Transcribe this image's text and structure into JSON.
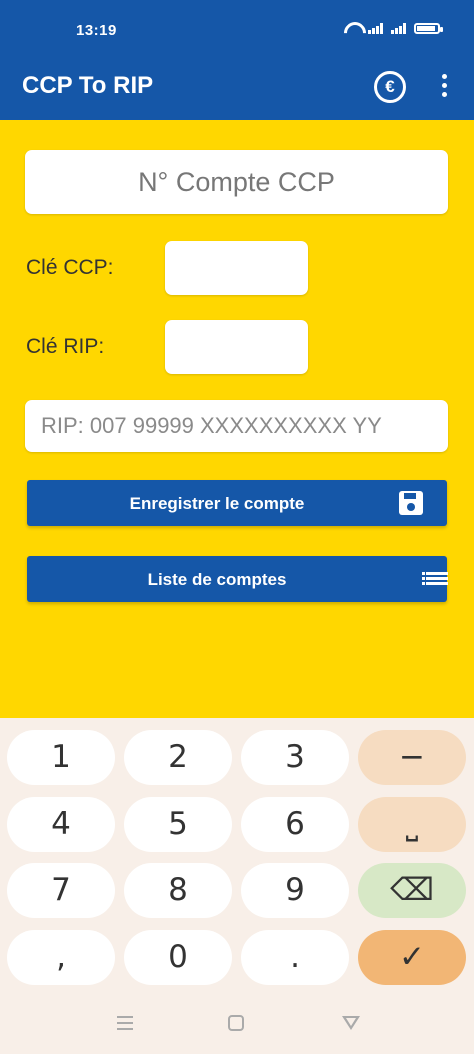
{
  "status_bar": {
    "time": "13:19"
  },
  "app_bar": {
    "title": "CCP To RIP",
    "currency_symbol": "€"
  },
  "form": {
    "ccp_placeholder": "N° Compte CCP",
    "cle_ccp_label": "Clé CCP:",
    "cle_rip_label": "Clé RIP:",
    "rip_placeholder": "RIP: 007 99999 XXXXXXXXXX YY",
    "save_button": "Enregistrer le compte",
    "list_button": "Liste de comptes"
  },
  "keyboard": {
    "keys": [
      "1",
      "2",
      "3",
      "−",
      "4",
      "5",
      "6",
      "⎵",
      "7",
      "8",
      "9",
      "⌫",
      ",",
      "0",
      ".",
      "✓"
    ]
  },
  "colors": {
    "primary": "#1557a8",
    "background": "#ffd700"
  }
}
